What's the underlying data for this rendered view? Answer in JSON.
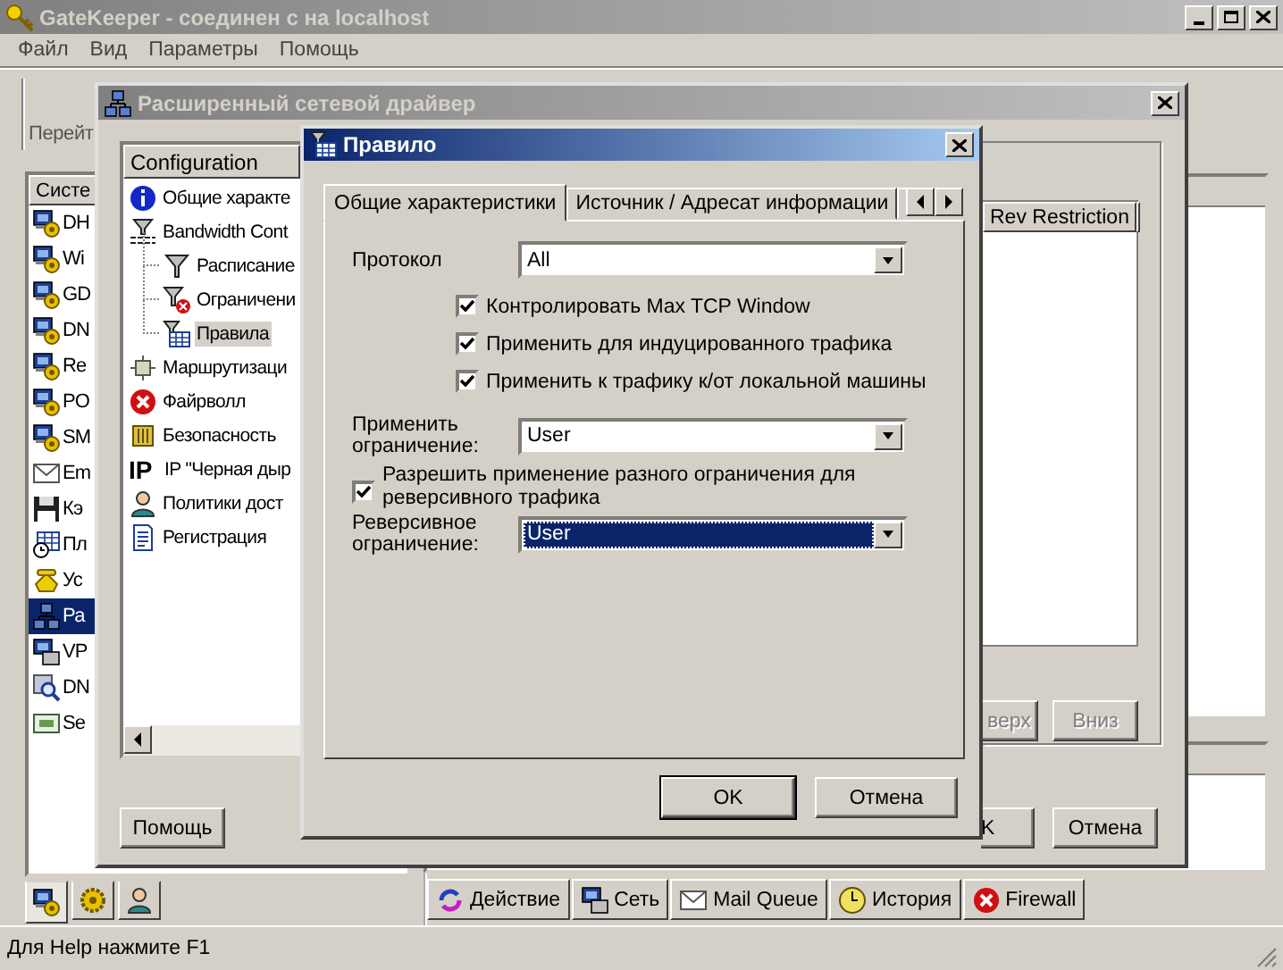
{
  "main_window": {
    "title": "GateKeeper - соединен с на localhost",
    "menu": [
      "Файл",
      "Вид",
      "Параметры",
      "Помощь"
    ],
    "toolbar_button": "Перейт",
    "services": {
      "header": "Систе",
      "items": [
        {
          "label": "DH",
          "selected": false
        },
        {
          "label": "Wi",
          "selected": false
        },
        {
          "label": "GD",
          "selected": false
        },
        {
          "label": "DN",
          "selected": false
        },
        {
          "label": "Re",
          "selected": false
        },
        {
          "label": "PO",
          "selected": false
        },
        {
          "label": "SM",
          "selected": false
        },
        {
          "label": "Em",
          "selected": false
        },
        {
          "label": "Кэ",
          "selected": false
        },
        {
          "label": "Пл",
          "selected": false
        },
        {
          "label": "Ус",
          "selected": false
        },
        {
          "label": "Ра",
          "selected": true
        },
        {
          "label": "VP",
          "selected": false
        },
        {
          "label": "DN",
          "selected": false
        },
        {
          "label": "Se",
          "selected": false
        }
      ]
    },
    "view_tabs": [
      {
        "selected": true
      },
      {
        "selected": false
      },
      {
        "selected": false
      }
    ],
    "bottom_tabs": [
      "Действие",
      "Сеть",
      "Mail Queue",
      "История",
      "Firewall"
    ],
    "status_bar": "Для Help нажмите F1"
  },
  "driver_window": {
    "title": "Расширенный сетевой драйвер",
    "tree": {
      "header": "Configuration",
      "items": [
        {
          "label": "Общие характе",
          "selected": false
        },
        {
          "label": "Bandwidth Cont",
          "selected": false,
          "children": [
            {
              "label": "Расписание",
              "selected": false
            },
            {
              "label": "Ограничени",
              "selected": false
            },
            {
              "label": "Правила",
              "selected": true
            }
          ]
        },
        {
          "label": "Маршрутизаци",
          "selected": false
        },
        {
          "label": "Файрволл",
          "selected": false
        },
        {
          "label": "Безопасность",
          "selected": false
        },
        {
          "label": "IP \"Черная дыр",
          "selected": false,
          "icon_text": "IP"
        },
        {
          "label": "Политики дост",
          "selected": false
        },
        {
          "label": "Регистрация",
          "selected": false
        }
      ]
    },
    "rules_table": {
      "columns": [
        "Rev Restriction"
      ]
    },
    "move_up_button": {
      "label": "верх",
      "disabled": true
    },
    "move_down_button": {
      "label": "Вниз",
      "disabled": true
    },
    "help_button": "Помощь",
    "ok_button": "K",
    "cancel_button": "Отмена"
  },
  "rule_dialog": {
    "title": "Правило",
    "tabs": [
      {
        "label": "Общие характеристики",
        "selected": true
      },
      {
        "label": "Источник / Адресат информации",
        "selected": false
      }
    ],
    "protocol": {
      "label": "Протокол",
      "value": "All"
    },
    "options": [
      {
        "label": "Контролировать Max TCP Window",
        "checked": true
      },
      {
        "label": "Применить для индуцированного трафика",
        "checked": true
      },
      {
        "label": "Применить к трафику к/от локальной машины",
        "checked": true
      }
    ],
    "restriction": {
      "label": "Применить ограничение:",
      "value": "User"
    },
    "allow_reverse": {
      "label": "Разрешить применение разного ограничения для реверсивного трафика",
      "checked": true
    },
    "reverse_restriction": {
      "label": "Реверсивное ограничение:",
      "value": "User",
      "focused": true
    },
    "buttons": [
      {
        "label": "OK",
        "default": true
      },
      {
        "label": "Отмена",
        "default": false
      }
    ]
  }
}
